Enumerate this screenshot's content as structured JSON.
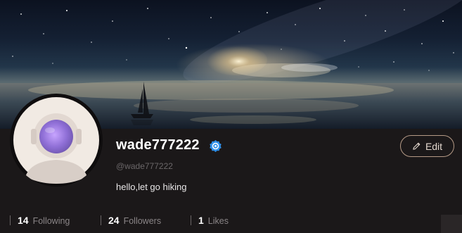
{
  "profile": {
    "username": "wade777222",
    "handle": "@wade777222",
    "bio": "hello,let go hiking"
  },
  "actions": {
    "edit_label": "Edit"
  },
  "stats": [
    {
      "value": "14",
      "label": "Following"
    },
    {
      "value": "24",
      "label": "Followers"
    },
    {
      "value": "1",
      "label": "Likes"
    }
  ],
  "icons": {
    "verified": "verified-badge-icon",
    "edit": "pencil-icon"
  },
  "colors": {
    "background": "#1b1819",
    "verified_badge": "#2f8fe8",
    "edit_border": "#b59a86"
  }
}
